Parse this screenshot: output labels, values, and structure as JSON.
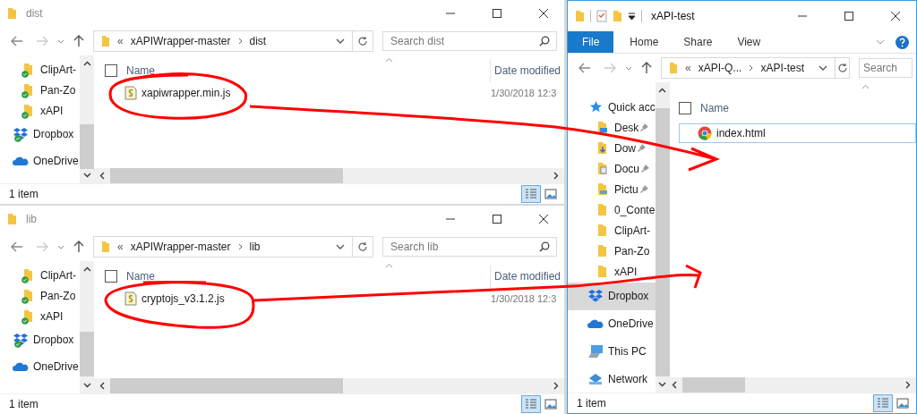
{
  "windows": [
    {
      "title": "dist",
      "active": false,
      "overflow": "«",
      "crumbs": [
        "xAPIWrapper-master",
        "dist"
      ],
      "search": {
        "placeholder": "Search dist"
      },
      "nav": [
        {
          "label": "ClipArt-",
          "kind": "folder",
          "synced": true,
          "pinned": false,
          "selected": false
        },
        {
          "label": "Pan-Zo",
          "kind": "folder",
          "synced": true,
          "pinned": false,
          "selected": false
        },
        {
          "label": "xAPI",
          "kind": "folder",
          "synced": true,
          "pinned": false,
          "selected": false
        },
        {
          "label": "Dropbox",
          "kind": "dropbox",
          "synced": true,
          "pinned": false,
          "selected": false
        },
        {
          "label": "OneDrive",
          "kind": "onedrive",
          "synced": false,
          "pinned": false,
          "selected": false
        }
      ],
      "select_all_checked": false,
      "columns": [
        "Name",
        "Date modified"
      ],
      "files": [
        {
          "name": "xapiwrapper.min.js",
          "kind": "script",
          "date": "1/30/2018 12:3",
          "selected": false
        }
      ],
      "status": "1 item"
    },
    {
      "title": "lib",
      "active": false,
      "overflow": "«",
      "crumbs": [
        "xAPIWrapper-master",
        "lib"
      ],
      "search": {
        "placeholder": "Search lib"
      },
      "nav": [
        {
          "label": "ClipArt-",
          "kind": "folder",
          "synced": true,
          "pinned": false,
          "selected": false
        },
        {
          "label": "Pan-Zo",
          "kind": "folder",
          "synced": true,
          "pinned": false,
          "selected": false
        },
        {
          "label": "xAPI",
          "kind": "folder",
          "synced": true,
          "pinned": false,
          "selected": false
        },
        {
          "label": "Dropbox",
          "kind": "dropbox",
          "synced": true,
          "pinned": false,
          "selected": false
        },
        {
          "label": "OneDrive",
          "kind": "onedrive",
          "synced": false,
          "pinned": false,
          "selected": false
        }
      ],
      "select_all_checked": false,
      "columns": [
        "Name",
        "Date modified"
      ],
      "files": [
        {
          "name": "cryptojs_v3.1.2.js",
          "kind": "script",
          "date": "1/30/2018 12:3",
          "selected": false
        }
      ],
      "status": "1 item"
    },
    {
      "title": "xAPI-test",
      "active": true,
      "ribbon": [
        {
          "label": "File",
          "kind": "file"
        },
        {
          "label": "Home",
          "kind": "tab"
        },
        {
          "label": "Share",
          "kind": "tab"
        },
        {
          "label": "View",
          "kind": "tab"
        }
      ],
      "overflow": "«",
      "crumbs": [
        "xAPI-Q...",
        "xAPI-test"
      ],
      "search": {
        "placeholder": "Search"
      },
      "nav": [
        {
          "label": "Quick acc",
          "kind": "quick",
          "synced": false,
          "pinned": false,
          "selected": false
        },
        {
          "label": "Desk",
          "kind": "desktop",
          "synced": false,
          "pinned": true,
          "selected": false
        },
        {
          "label": "Dow",
          "kind": "downloads",
          "synced": false,
          "pinned": true,
          "selected": false
        },
        {
          "label": "Docu",
          "kind": "documents",
          "synced": false,
          "pinned": true,
          "selected": false
        },
        {
          "label": "Pictu",
          "kind": "pictures",
          "synced": false,
          "pinned": true,
          "selected": false
        },
        {
          "label": "0_Conte",
          "kind": "folder",
          "synced": false,
          "pinned": false,
          "selected": false
        },
        {
          "label": "ClipArt-",
          "kind": "folder",
          "synced": false,
          "pinned": false,
          "selected": false
        },
        {
          "label": "Pan-Zo",
          "kind": "folder",
          "synced": false,
          "pinned": false,
          "selected": false
        },
        {
          "label": "xAPI",
          "kind": "folder",
          "synced": false,
          "pinned": false,
          "selected": false
        },
        {
          "label": "Dropbox",
          "kind": "dropbox",
          "synced": false,
          "pinned": false,
          "selected": true
        },
        {
          "label": "OneDrive",
          "kind": "onedrive",
          "synced": false,
          "pinned": false,
          "selected": false
        },
        {
          "label": "This PC",
          "kind": "pc",
          "synced": false,
          "pinned": false,
          "selected": false
        },
        {
          "label": "Network",
          "kind": "network",
          "synced": false,
          "pinned": false,
          "selected": false
        }
      ],
      "select_all_checked": false,
      "columns": [
        "Name"
      ],
      "files": [
        {
          "name": "index.html",
          "kind": "web",
          "selected": true
        }
      ],
      "status": "1 item"
    }
  ]
}
